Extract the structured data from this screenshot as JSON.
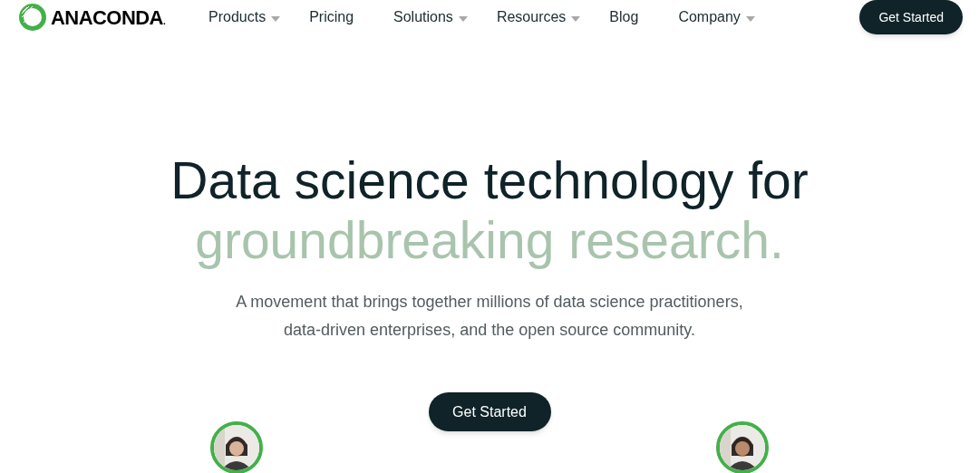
{
  "header": {
    "logo_text": "ANACONDA",
    "logo_mark": ".",
    "nav": [
      {
        "label": "Products",
        "kind": "dropdown"
      },
      {
        "label": "Pricing",
        "kind": "link"
      },
      {
        "label": "Solutions",
        "kind": "dropdown"
      },
      {
        "label": "Resources",
        "kind": "dropdown"
      },
      {
        "label": "Blog",
        "kind": "link"
      },
      {
        "label": "Company",
        "kind": "dropdown"
      }
    ],
    "cta": "Get Started"
  },
  "hero": {
    "headline": "Data science technology for",
    "headline_faded": "groundbreaking research.",
    "subtitle_lines": [
      "A movement that brings together millions of data science practitioners,",
      "data-driven enterprises, and the open source community."
    ],
    "cta": "Get Started"
  }
}
